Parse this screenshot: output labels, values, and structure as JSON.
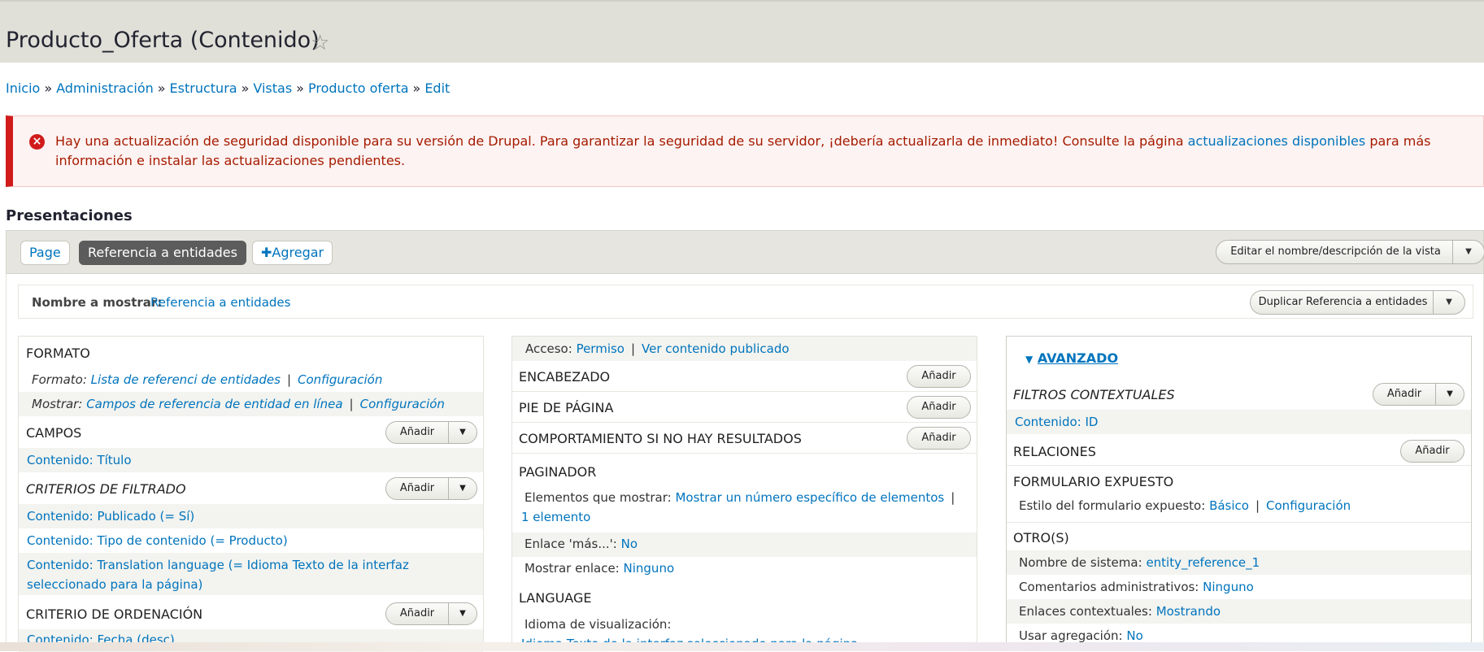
{
  "header": {
    "title": "Producto_Oferta (Contenido)",
    "star_icon": "star-icon"
  },
  "breadcrumb": {
    "items": [
      "Inicio",
      "Administración",
      "Estructura",
      "Vistas",
      "Producto oferta",
      "Edit"
    ],
    "sep": "»"
  },
  "alert": {
    "text_before": "Hay una actualización de seguridad disponible para su versión de Drupal. Para garantizar la seguridad de su servidor, ¡debería actualizarla de inmediato! Consulte la página ",
    "link": "actualizaciones disponibles",
    "text_after": " para más información e instalar las actualizaciones pendientes.",
    "icon": "x-circle-icon",
    "color": "#d11b1b"
  },
  "displays": {
    "title": "Presentaciones",
    "tabs": [
      "Page",
      "Referencia a entidades",
      "Agregar"
    ],
    "edit_name_button": "Editar el nombre/descripción de la vista"
  },
  "name_row": {
    "label": "Nombre a mostrar:",
    "value": "Referencia a entidades",
    "duplicate_button": "Duplicar Referencia a entidades"
  },
  "left": {
    "formato": {
      "title": "FORMATO",
      "format_label": "Formato:",
      "format_value": "Lista de referenci de entidades",
      "format_config": "Configuración",
      "show_label": "Mostrar:",
      "show_value": "Campos de referencia de entidad en línea",
      "show_config": "Configuración"
    },
    "campos": {
      "title": "CAMPOS",
      "add": "Añadir",
      "items": [
        "Contenido: Título"
      ]
    },
    "filtros": {
      "title": "CRITERIOS DE FILTRADO",
      "add": "Añadir",
      "items": [
        "Contenido: Publicado (= Sí)",
        "Contenido: Tipo de contenido (= Producto)",
        "Contenido: Translation language (= Idioma Texto de la interfaz",
        "seleccionado para la página)"
      ]
    },
    "orden": {
      "title": "CRITERIO DE ORDENACIÓN",
      "add": "Añadir",
      "items": [
        "Contenido: Fecha (desc)"
      ]
    }
  },
  "middle": {
    "acceso_label": "Acceso:",
    "acceso_value": "Permiso",
    "acceso_value2": "Ver contenido publicado",
    "encabezado": "ENCABEZADO",
    "pie": "PIE DE PÁGINA",
    "comport": "COMPORTAMIENTO SI NO HAY RESULTADOS",
    "add": "Añadir",
    "paginador": {
      "title": "PAGINADOR",
      "items_label": "Elementos que mostrar:",
      "items_value": "Mostrar un número específico de elementos",
      "items_value2": "1 elemento",
      "more_label": "Enlace 'más...':",
      "more_value": "No",
      "show_link_label": "Mostrar enlace:",
      "show_link_value": "Ninguno"
    },
    "language": {
      "title": "LANGUAGE",
      "label": "Idioma de visualización:",
      "value": "Idioma Texto de la interfaz seleccionado para la página"
    }
  },
  "right": {
    "avanzado": "AVANZADO",
    "filtros_ctx": {
      "title": "FILTROS CONTEXTUALES",
      "add": "Añadir",
      "items": [
        "Contenido: ID"
      ]
    },
    "relaciones": {
      "title": "RELACIONES",
      "add": "Añadir"
    },
    "form_exp": {
      "title": "FORMULARIO EXPUESTO",
      "label": "Estilo del formulario expuesto:",
      "value": "Básico",
      "config": "Configuración"
    },
    "otros": {
      "title": "OTRO(S)",
      "sys_label": "Nombre de sistema:",
      "sys_value": "entity_reference_1",
      "admin_label": "Comentarios administrativos:",
      "admin_value": "Ninguno",
      "ctx_label": "Enlaces contextuales:",
      "ctx_value": "Mostrando",
      "agg_label": "Usar agregación:",
      "agg_value": "No"
    }
  }
}
